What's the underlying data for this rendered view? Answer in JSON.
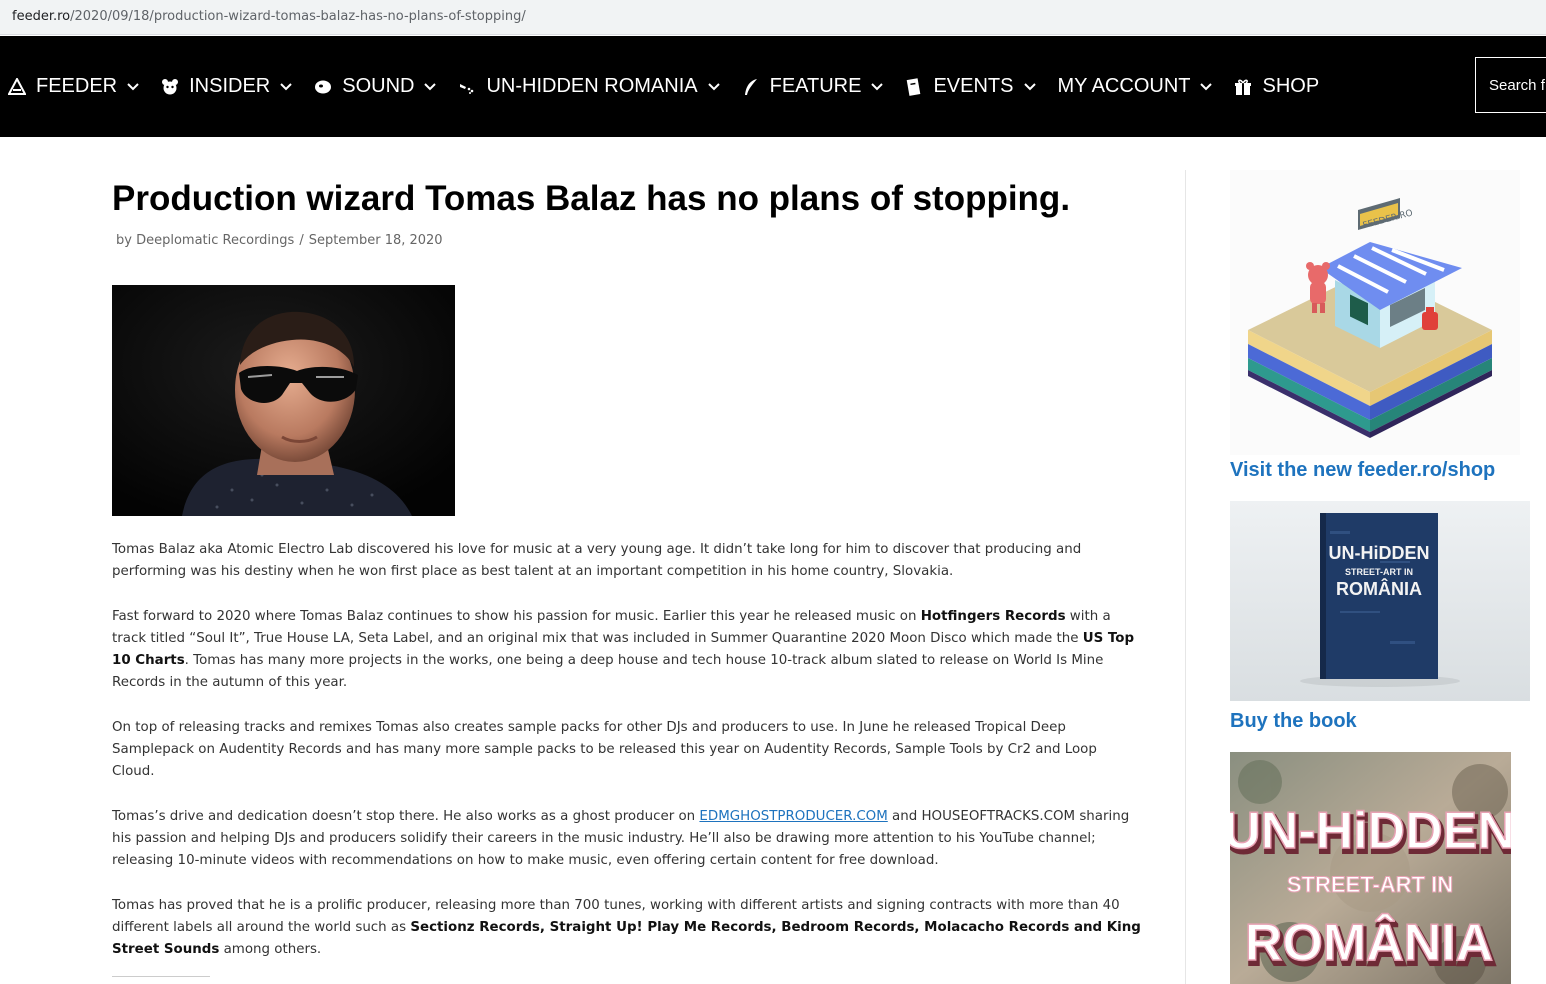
{
  "browser": {
    "url_host": "feeder.ro",
    "url_path": "/2020/09/18/production-wizard-tomas-balaz-has-no-plans-of-stopping/"
  },
  "nav": {
    "items": [
      {
        "label": "FEEDER",
        "icon": "triangle-logo-icon"
      },
      {
        "label": "INSIDER",
        "icon": "bear-icon"
      },
      {
        "label": "SOUND",
        "icon": "blob-icon"
      },
      {
        "label": "UN-HIDDEN ROMANIA",
        "icon": "spray-icon"
      },
      {
        "label": "FEATURE",
        "icon": "feather-icon"
      },
      {
        "label": "EVENTS",
        "icon": "ticket-icon"
      },
      {
        "label": "MY ACCOUNT",
        "icon": null
      },
      {
        "label": "SHOP",
        "icon": "gift-icon"
      }
    ],
    "search_placeholder": "Search f"
  },
  "article": {
    "title": "Production wizard Tomas Balaz has no plans of stopping.",
    "byline": "by Deeplomatic Recordings",
    "separator": "/",
    "date": "September 18, 2020",
    "p1": "Tomas Balaz aka Atomic Electro Lab discovered his love for music at a very young age. It didn’t take long for him to discover that producing and performing was his destiny when he won first place as best talent at an important competition in his home country, Slovakia.",
    "p2_a": "Fast forward to 2020 where Tomas Balaz continues to show his passion for music. Earlier this year he released music on ",
    "p2_b": "Hotfingers Records",
    "p2_c": " with a track titled “Soul It”, True House LA, Seta Label, and an original mix that was included in Summer Quarantine 2020 Moon Disco which made the ",
    "p2_d": "US Top 10 Charts",
    "p2_e": ". Tomas has many more projects in the works, one being a deep house and tech house 10-track album slated to release on World Is Mine Records in the autumn of this year.",
    "p3": "On top of releasing tracks and remixes Tomas also creates sample packs for other DJs and producers to use. In June he released Tropical Deep Samplepack on Audentity Records and has many more sample packs to be released this year on Audentity Records, Sample Tools by Cr2 and Loop Cloud.",
    "p4_a": "Tomas’s drive and dedication doesn’t stop there. He also works as a ghost producer on ",
    "p4_link": "EDMGHOSTPRODUCER.COM",
    "p4_b": " and HOUSEOFTRACKS.COM sharing his passion and helping DJs and producers solidify their careers in the music industry. He’ll also be drawing more attention to his YouTube channel; releasing 10-minute videos with recommendations on how to make music, even offering certain content for free download.",
    "p5_a": "Tomas has proved that he is a prolific producer, releasing more than 700 tunes, working with different artists and signing contracts with more than 40 different labels all around the world such as ",
    "p5_b": "Sectionz Records, Straight Up! Play Me Records, Bedroom Records, Molacacho Records and King Street Sounds",
    "p5_c": " among others."
  },
  "sidebar": {
    "shop_sign": "FEEDER.RO",
    "shop_link": "Visit the new feeder.ro/shop",
    "book_link": "Buy the book",
    "book_cover": {
      "line1": "UN-HiDDEN",
      "line2": "STREET-ART IN",
      "line3": "ROMÂNIA"
    },
    "art": {
      "line1": "UN-HiDDEN",
      "line2": "STREET-ART IN",
      "line3": "ROMÂNIA"
    }
  },
  "colors": {
    "nav_bg": "#000000",
    "link": "#1e73be",
    "title": "#000000"
  }
}
